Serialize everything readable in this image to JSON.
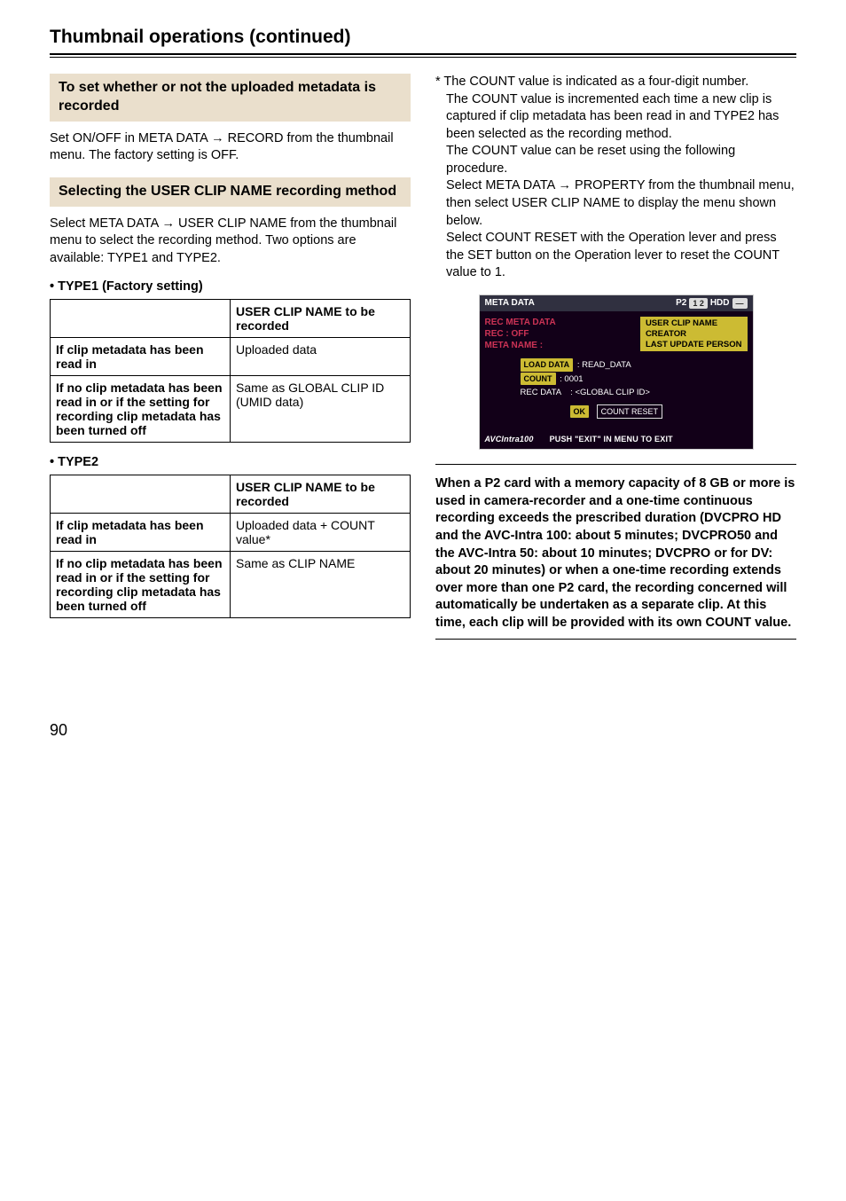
{
  "page": {
    "title": "Thumbnail operations (continued)",
    "number": "90"
  },
  "left": {
    "sub1": {
      "heading": "To set whether or not the uploaded metadata is recorded",
      "para": "Set ON/OFF in META DATA → RECORD from the thumbnail menu. The factory setting is OFF."
    },
    "sub2": {
      "heading": "Selecting the USER CLIP NAME recording method",
      "para": "Select META DATA → USER CLIP NAME from the thumbnail menu to select the recording method. Two options are available: TYPE1 and TYPE2."
    },
    "type1": {
      "label": "TYPE1 (Factory setting)",
      "header_blank": "",
      "header_value": "USER CLIP NAME to be recorded",
      "row1_label": "If clip metadata has been read in",
      "row1_value": "Uploaded data",
      "row2_label": "If no clip metadata has been read in or if the setting for recording clip metadata has been turned off",
      "row2_value": "Same as GLOBAL CLIP ID (UMID data)"
    },
    "type2": {
      "label": "TYPE2",
      "header_blank": "",
      "header_value": "USER CLIP NAME to be recorded",
      "row1_label": "If clip metadata has been read in",
      "row1_value": "Uploaded data + COUNT value*",
      "row2_label": "If no clip metadata has been read in or if the setting for recording clip metadata has been turned off",
      "row2_value": "Same as CLIP NAME"
    }
  },
  "right": {
    "footnote": {
      "star_line": "* The COUNT value is indicated as a four-digit number.",
      "p1": "The COUNT value is incremented each time a new clip is captured if clip metadata has been read in and TYPE2 has been selected as the recording method.",
      "p2": "The COUNT value can be reset using the following procedure.",
      "p3": "Select META DATA → PROPERTY from the thumbnail menu, then select USER CLIP NAME to display the menu shown below.",
      "p4": "Select COUNT RESET with the Operation lever and press the SET button on the Operation lever to reset the COUNT value to 1."
    },
    "screenshot": {
      "title": "META DATA",
      "chip_p2": "P2",
      "chip_slots": "1 2",
      "chip_hdd": "HDD",
      "meta_left_l1": "REC META DATA",
      "meta_left_l2": "REC : OFF",
      "meta_left_l3": "META NAME :",
      "userclip_l1": "USER CLIP NAME",
      "userclip_l2": "CREATOR",
      "userclip_l3": "LAST UPDATE PERSON",
      "load_data_btn": "LOAD DATA",
      "load_data_val": ": READ_DATA",
      "count_btn": "COUNT",
      "count_val": ": 0001",
      "rec_data_label": "REC DATA",
      "rec_data_val": ": <GLOBAL CLIP ID>",
      "ok_btn": "OK",
      "count_reset_btn": "COUNT RESET",
      "brand": "AVCIntra100",
      "exit_msg": "PUSH \"EXIT\" IN MENU TO EXIT"
    },
    "note": "When a P2 card with a memory capacity of 8 GB or more is used in camera-recorder and a one-time continuous recording exceeds the prescribed duration (DVCPRO HD and the AVC-Intra 100: about 5 minutes; DVCPRO50 and the AVC-Intra 50: about 10 minutes; DVCPRO or for DV: about 20 minutes) or when a one-time recording extends over more than one P2 card, the recording concerned will automatically be undertaken as a separate clip. At this time, each clip will be provided with its own COUNT value."
  }
}
